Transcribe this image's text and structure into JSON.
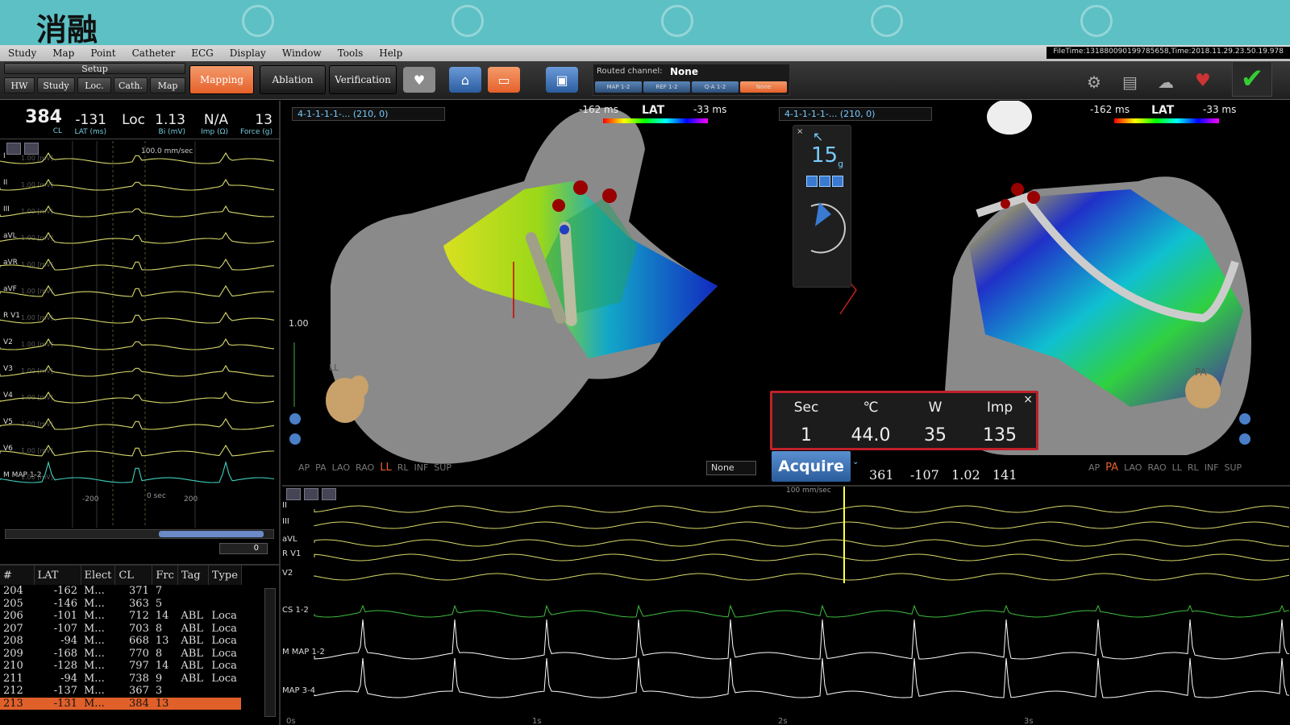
{
  "banner": {
    "title": "消融"
  },
  "menu": [
    "Study",
    "Map",
    "Point",
    "Catheter",
    "ECG",
    "Display",
    "Window",
    "Tools",
    "Help"
  ],
  "filetime": "FileTime:131880090199785658,Time:2018.11.29.23.50.19.978",
  "toolbar": {
    "setup_label": "Setup",
    "setup_tabs": [
      "HW",
      "Study",
      "Loc.",
      "Cath.",
      "Map"
    ],
    "modes": [
      "Mapping",
      "Ablation",
      "Verification"
    ],
    "routed_label": "Routed channel:",
    "routed_value": "None",
    "routed_buttons": [
      "MAP 1-2",
      "REF 1-2",
      "Q-A 1-2",
      "None"
    ]
  },
  "stats": [
    {
      "value": "384",
      "label": "CL"
    },
    {
      "value": "-131",
      "label": "LAT (ms)"
    },
    {
      "value": "Loc",
      "label": ""
    },
    {
      "value": "1.13",
      "label": "Bi (mV)"
    },
    {
      "value": "N/A",
      "label": "Imp (Ω)"
    },
    {
      "value": "13",
      "label": "Force (g)"
    }
  ],
  "ecg": {
    "speed": "100.0 mm/sec",
    "leads": [
      "I",
      "II",
      "III",
      "aVL",
      "aVR",
      "aVF",
      "R V1",
      "V2",
      "V3",
      "V4",
      "V5",
      "V6",
      "M MAP 1-2"
    ],
    "unit": "1.00 [mV]",
    "axis": [
      "-200",
      "0 sec",
      "200"
    ],
    "page": "0"
  },
  "table": {
    "headers": [
      "#",
      "LAT",
      "Elect",
      "CL",
      "Frc",
      "Tag",
      "Type"
    ],
    "rows": [
      [
        "204",
        "-162",
        "M...",
        "371",
        "7",
        "",
        ""
      ],
      [
        "205",
        "-146",
        "M...",
        "363",
        "5",
        "",
        ""
      ],
      [
        "206",
        "-101",
        "M...",
        "712",
        "14",
        "ABL",
        "Loca"
      ],
      [
        "207",
        "-107",
        "M...",
        "703",
        "8",
        "ABL",
        "Loca"
      ],
      [
        "208",
        "-94",
        "M...",
        "668",
        "13",
        "ABL",
        "Loca"
      ],
      [
        "209",
        "-168",
        "M...",
        "770",
        "8",
        "ABL",
        "Loca"
      ],
      [
        "210",
        "-128",
        "M...",
        "797",
        "14",
        "ABL",
        "Loca"
      ],
      [
        "211",
        "-94",
        "M...",
        "738",
        "9",
        "ABL",
        "Loca"
      ],
      [
        "212",
        "-137",
        "M...",
        "367",
        "3",
        "",
        ""
      ],
      [
        "213",
        "-131",
        "M...",
        "384",
        "13",
        "",
        ""
      ]
    ],
    "selected_row": 9
  },
  "view1": {
    "dropdown": "4-1-1-1-1-... (210, 0)",
    "lat_left": "-162 ms",
    "lat_title": "LAT",
    "lat_right": "-33 ms",
    "scale": "1.00",
    "orient_label": "LL",
    "views": [
      "AP",
      "PA",
      "LAO",
      "RAO",
      "LL",
      "RL",
      "INF",
      "SUP"
    ],
    "active_view": "LL",
    "none_dropdown": "None"
  },
  "view2": {
    "dropdown": "4-1-1-1-1-... (210, 0)",
    "lat_left": "-162 ms",
    "lat_title": "LAT",
    "lat_right": "-33 ms",
    "orient_label": "PA",
    "views": [
      "AP",
      "PA",
      "LAO",
      "RAO",
      "LL",
      "RL",
      "INF",
      "SUP"
    ],
    "active_view": "PA",
    "force_value": "15",
    "force_unit": "g"
  },
  "ablation": {
    "headers": [
      "Sec",
      "℃",
      "W",
      "Imp"
    ],
    "values": [
      "1",
      "44.0",
      "35",
      "135"
    ],
    "acquire": "Acquire",
    "readout": [
      "361",
      "-107",
      "1.02",
      "141"
    ]
  },
  "bottom": {
    "speed": "100 mm/sec",
    "leads": [
      "II",
      "III",
      "aVL",
      "R V1",
      "V2",
      "CS 1-2",
      "M MAP 1-2",
      "MAP 3-4"
    ],
    "time_axis": [
      "0s",
      "1s",
      "2s",
      "3s"
    ]
  },
  "colors": {
    "accent": "#e5612a",
    "banner": "#5cc0c4",
    "alert": "#c0202a",
    "ecg": "#d8d86a",
    "cs": "#3fbf3f",
    "map": "#ffffff"
  }
}
